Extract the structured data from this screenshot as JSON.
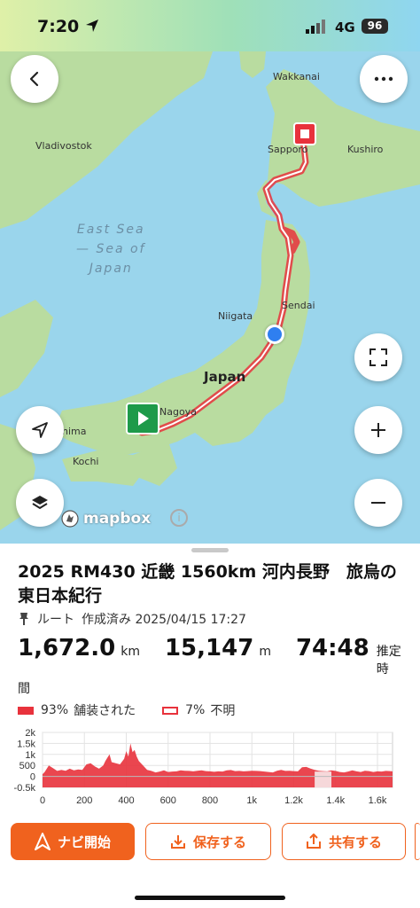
{
  "status": {
    "time": "7:20",
    "network": "4G",
    "battery": "96"
  },
  "map": {
    "labels": {
      "wakkanai": "Wakkanai",
      "sapporo": "Sapporo",
      "kushiro": "Kushiro",
      "vladivostok": "Vladivostok",
      "sendai": "Sendai",
      "niigata": "Niigata",
      "japan": "Japan",
      "nagoya": "Nagoya",
      "kochi": "Kochi",
      "hima": "hima"
    },
    "sea_label": [
      "East Sea",
      "— Sea of",
      "Japan"
    ],
    "attribution": "mapbox",
    "colors": {
      "route": "#e8323c",
      "land": "#b9dca0",
      "water": "#9ad5ec",
      "start": "#1e9a4a",
      "finish": "#e8323c",
      "current": "#2f7ff0"
    }
  },
  "buttons": {
    "back": "chevron-left-icon",
    "more": "ellipsis-icon",
    "fullscreen": "fullscreen-icon",
    "zoom_in": "plus-icon",
    "zoom_out": "minus-icon",
    "locate": "navigation-arrow-icon",
    "layers": "layers-icon"
  },
  "route": {
    "title": "2025 RM430 近畿 1560km 河内長野　旅烏の東日本紀行",
    "type_label": "ルート",
    "created_label": "作成済み 2025/04/15 17:27",
    "distance": "1,672.0",
    "distance_unit": "km",
    "elevation": "15,147",
    "elevation_unit": "m",
    "duration": "74:48",
    "duration_unit": "推定時間"
  },
  "surface": [
    {
      "percent": "93%",
      "label": "舗装された",
      "color": "#e8323c",
      "style": "filled"
    },
    {
      "percent": "7%",
      "label": "不明",
      "color": "#e8323c",
      "style": "outline"
    }
  ],
  "chart_data": {
    "type": "area",
    "y_ticks": [
      "2k",
      "1.5k",
      "1k",
      "500",
      "0",
      "-0.5k"
    ],
    "y_tick_values": [
      2000,
      1500,
      1000,
      500,
      0,
      -500
    ],
    "x_ticks": [
      "0",
      "200",
      "400",
      "600",
      "800",
      "1k",
      "1.2k",
      "1.4k",
      "1.6k"
    ],
    "x_tick_values": [
      0,
      200,
      400,
      600,
      800,
      1000,
      1200,
      1400,
      1600
    ],
    "xlim": [
      0,
      1672
    ],
    "ylim": [
      -500,
      2000
    ],
    "x": [
      0,
      10,
      30,
      50,
      70,
      90,
      110,
      130,
      150,
      170,
      190,
      210,
      230,
      250,
      270,
      290,
      300,
      310,
      320,
      330,
      350,
      370,
      390,
      400,
      410,
      420,
      430,
      440,
      450,
      460,
      480,
      500,
      520,
      540,
      560,
      580,
      600,
      620,
      640,
      660,
      680,
      700,
      720,
      740,
      760,
      780,
      800,
      820,
      840,
      860,
      880,
      900,
      920,
      940,
      960,
      980,
      1000,
      1020,
      1040,
      1060,
      1080,
      1100,
      1120,
      1140,
      1160,
      1180,
      1200,
      1220,
      1240,
      1260,
      1280,
      1300,
      1320,
      1340,
      1360,
      1380,
      1400,
      1420,
      1440,
      1460,
      1480,
      1500,
      1520,
      1540,
      1560,
      1580,
      1600,
      1620,
      1640,
      1660,
      1672
    ],
    "y": [
      100,
      200,
      500,
      380,
      250,
      300,
      260,
      350,
      280,
      320,
      300,
      550,
      600,
      450,
      350,
      500,
      700,
      850,
      1000,
      650,
      600,
      550,
      800,
      1150,
      900,
      1500,
      1100,
      1200,
      900,
      700,
      500,
      300,
      250,
      180,
      220,
      280,
      200,
      220,
      230,
      280,
      260,
      250,
      230,
      260,
      280,
      240,
      230,
      210,
      230,
      220,
      280,
      290,
      240,
      250,
      230,
      240,
      260,
      250,
      240,
      220,
      200,
      180,
      260,
      300,
      250,
      260,
      240,
      230,
      420,
      430,
      360,
      300,
      260,
      240,
      230,
      280,
      250,
      200,
      180,
      220,
      280,
      230,
      200,
      260,
      240,
      200,
      230,
      220,
      250,
      240,
      230
    ],
    "colors": {
      "paved": "#e8323c",
      "unknown_band": "#f6d8da"
    }
  },
  "actions": {
    "navigate": "ナビ開始",
    "save": "保存する",
    "share": "共有する"
  }
}
